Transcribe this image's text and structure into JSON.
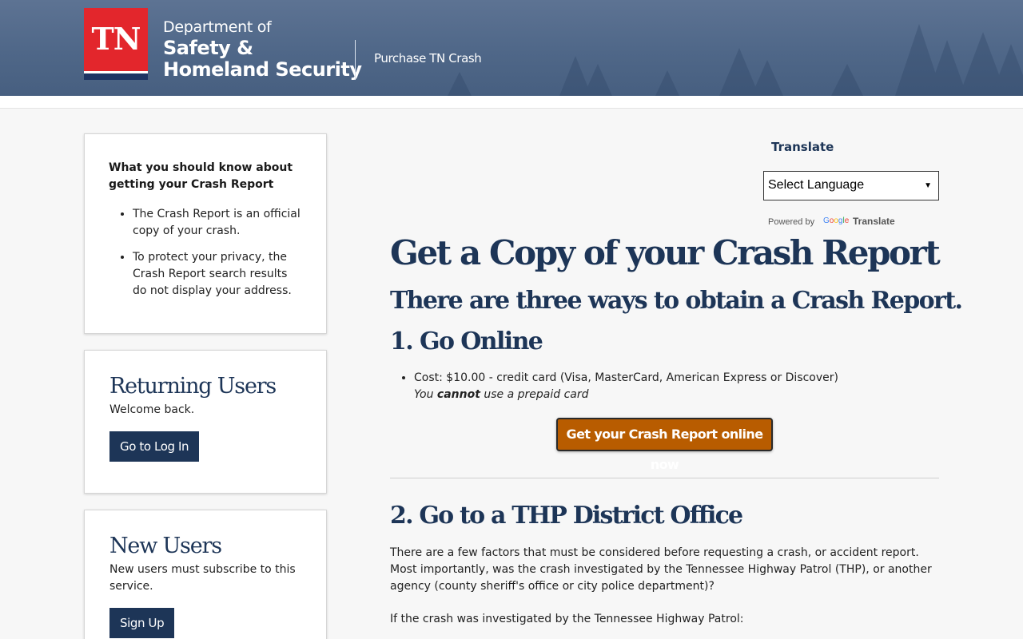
{
  "header": {
    "logo_text": "TN",
    "dept_line1": "Department of",
    "dept_line2": "Safety &",
    "dept_line3": "Homeland Security",
    "app_title": "Purchase TN Crash"
  },
  "sidebar": {
    "info_card": {
      "title": "What you should know about getting your Crash Report",
      "items": [
        "The Crash Report is an official copy of your crash.",
        "To protect your privacy, the Crash Report search results do not display your address."
      ]
    },
    "returning_users": {
      "title": "Returning Users",
      "text": "Welcome back.",
      "button": "Go to Log In"
    },
    "new_users": {
      "title": "New Users",
      "text": "New users must subscribe to this service.",
      "button": "Sign Up"
    }
  },
  "translate": {
    "label": "Translate",
    "selected": "Select Language",
    "powered_by": "Powered by",
    "google": "Google",
    "translate_word": "Translate"
  },
  "main": {
    "title": "Get a Copy of your Crash Report",
    "subtitle": "There are three ways to obtain a Crash Report.",
    "section1": {
      "heading": "1. Go Online",
      "cost": "Cost: $10.00 - credit card (Visa, MasterCard, American Express or Discover)",
      "note_pre": "You ",
      "note_strong": "cannot",
      "note_post": " use a prepaid card",
      "button": "Get your Crash Report online now"
    },
    "section2": {
      "heading": "2. Go to a THP District Office",
      "para1": "There are a few factors that must be considered before requesting a crash, or accident report. Most importantly, was the crash investigated by the Tennessee Highway Patrol (THP), or another agency (county sheriff's office or city police department)?",
      "para2": "If the crash was investigated by the Tennessee Highway Patrol:"
    }
  },
  "colors": {
    "navy": "#1d3557",
    "orange": "#b85c00",
    "red": "#e3262c"
  }
}
